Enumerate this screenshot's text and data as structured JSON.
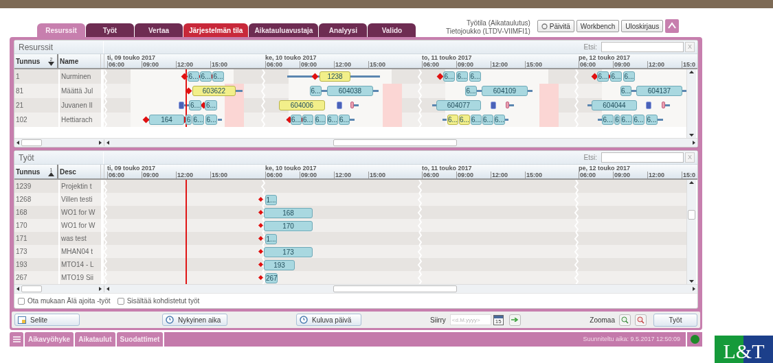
{
  "header": {
    "workspace": "Työtila (Aikataulutus)",
    "dataset": "Tietojoukko (LTDV-VIIMFI1)",
    "buttons": [
      {
        "label": "Päivitä",
        "kind": "refresh"
      },
      {
        "label": "Workbench",
        "kind": "plain"
      },
      {
        "label": "Uloskirjaus",
        "kind": "plain"
      }
    ]
  },
  "tabs": [
    {
      "label": "Resurssit",
      "selected": true,
      "warning": false
    },
    {
      "label": "Työt",
      "selected": false,
      "warning": false
    },
    {
      "label": "Vertaa",
      "selected": false,
      "warning": false
    },
    {
      "label": "Järjestelmän tila",
      "selected": false,
      "warning": true
    },
    {
      "label": "Aikatauluavustaja",
      "selected": false,
      "warning": false
    },
    {
      "label": "Analyysi",
      "selected": false,
      "warning": false
    },
    {
      "label": "Valido",
      "selected": false,
      "warning": false
    }
  ],
  "resources_panel": {
    "title": "Resurssit",
    "search_label": "Etsi:",
    "clear_button": "X",
    "columns": [
      {
        "label": "Tunnus",
        "sort_rank": "2",
        "ascending": false
      },
      {
        "label": "Name"
      }
    ],
    "days": [
      {
        "label": "ti, 09 touko 2017",
        "ticks": [
          "06:00",
          "09:00",
          "12:00",
          "15:00"
        ]
      },
      {
        "label": "ke, 10 touko 2017",
        "ticks": [
          "06:00",
          "09:00",
          "12:00",
          "15:00"
        ]
      },
      {
        "label": "to, 11 touko 2017",
        "ticks": [
          "06:00",
          "09:00",
          "12:00",
          "15:00"
        ]
      },
      {
        "label": "pe, 12 touko 2017",
        "ticks": [
          "06:00",
          "09:00",
          "12:00",
          "15:0"
        ]
      }
    ],
    "rows": [
      {
        "id": "1",
        "name": "Nurminen",
        "bars": [
          {
            "label": "6...",
            "color": "#a9d8e0"
          },
          {
            "label": "6...",
            "color": "#a9d8e0"
          },
          {
            "label": "6...",
            "color": "#a9d8e0"
          },
          {
            "label": "1238",
            "color": "#f2ef8a"
          },
          {
            "label": "6...",
            "color": "#a9d8e0"
          },
          {
            "label": "6...",
            "color": "#a9d8e0"
          },
          {
            "label": "6...",
            "color": "#a9d8e0"
          },
          {
            "label": "6...",
            "color": "#a9d8e0"
          },
          {
            "label": "6...",
            "color": "#a9d8e0"
          },
          {
            "label": "6...",
            "color": "#a9d8e0"
          }
        ]
      },
      {
        "id": "81",
        "name": "Määttä Jul",
        "bars": [
          {
            "label": "603622",
            "color": "#f2ef8a"
          },
          {
            "label": "6...",
            "color": "#a9d8e0"
          },
          {
            "label": "604038",
            "color": "#a9d8e0"
          },
          {
            "label": "6...",
            "color": "#a9d8e0"
          },
          {
            "label": "604109",
            "color": "#a9d8e0"
          },
          {
            "label": "6...",
            "color": "#a9d8e0"
          },
          {
            "label": "604137",
            "color": "#a9d8e0"
          }
        ]
      },
      {
        "id": "21",
        "name": "Juvanen Il",
        "bars": [
          {
            "label": "6...",
            "color": "#a9d8e0"
          },
          {
            "label": "6...",
            "color": "#a9d8e0"
          },
          {
            "label": "604006",
            "color": "#f2ef8a"
          },
          {
            "label": "604077",
            "color": "#a9d8e0"
          },
          {
            "label": "604044",
            "color": "#a9d8e0"
          }
        ]
      },
      {
        "id": "102",
        "name": "Hettiarach",
        "bars": [
          {
            "label": "164",
            "color": "#a9d8e0"
          },
          {
            "label": "6",
            "color": "#a9d8e0"
          },
          {
            "label": "6...",
            "color": "#a9d8e0"
          },
          {
            "label": "6...",
            "color": "#a9d8e0"
          },
          {
            "label": "6...",
            "color": "#a9d8e0"
          },
          {
            "label": "6...",
            "color": "#a9d8e0"
          },
          {
            "label": "6...",
            "color": "#a9d8e0"
          },
          {
            "label": "6...",
            "color": "#a9d8e0"
          },
          {
            "label": "6...",
            "color": "#a9d8e0"
          },
          {
            "label": "6...",
            "color": "#f2ef8a"
          },
          {
            "label": "6...",
            "color": "#f2ef8a"
          },
          {
            "label": "6...",
            "color": "#a9d8e0"
          },
          {
            "label": "6...",
            "color": "#a9d8e0"
          },
          {
            "label": "6...",
            "color": "#a9d8e0"
          },
          {
            "label": "6...",
            "color": "#a9d8e0"
          },
          {
            "label": "6",
            "color": "#a9d8e0"
          },
          {
            "label": "6...",
            "color": "#a9d8e0"
          },
          {
            "label": "6...",
            "color": "#a9d8e0"
          },
          {
            "label": "6...",
            "color": "#a9d8e0"
          }
        ]
      }
    ]
  },
  "jobs_panel": {
    "title": "Työt",
    "search_label": "Etsi:",
    "clear_button": "X",
    "columns": [
      {
        "label": "Tunnus",
        "sort_rank": "1",
        "ascending": true
      },
      {
        "label": "Desc"
      }
    ],
    "days": [
      {
        "label": "ti, 09 touko 2017",
        "ticks": [
          "06:00",
          "09:00",
          "12:00",
          "15:00"
        ]
      },
      {
        "label": "ke, 10 touko 2017",
        "ticks": [
          "06:00",
          "09:00",
          "12:00",
          "15:00"
        ]
      },
      {
        "label": "to, 11 touko 2017",
        "ticks": [
          "06:00",
          "09:00",
          "12:00",
          "15:00"
        ]
      },
      {
        "label": "pe, 12 touko 2017",
        "ticks": [
          "06:00",
          "09:00",
          "12:00",
          "15:0"
        ]
      }
    ],
    "rows": [
      {
        "id": "1239",
        "name": "Projektin t",
        "bars": []
      },
      {
        "id": "1268",
        "name": "Villen testi",
        "bars": [
          {
            "label": "1...",
            "color": "#a9d8e0"
          }
        ]
      },
      {
        "id": "168",
        "name": "WO1 for W",
        "bars": [
          {
            "label": "168",
            "color": "#a9d8e0"
          }
        ]
      },
      {
        "id": "170",
        "name": "WO1 for W",
        "bars": [
          {
            "label": "170",
            "color": "#a9d8e0"
          }
        ]
      },
      {
        "id": "171",
        "name": "was test",
        "bars": [
          {
            "label": "1...",
            "color": "#a9d8e0"
          }
        ]
      },
      {
        "id": "173",
        "name": "MHAN04 t",
        "bars": [
          {
            "label": "173",
            "color": "#a9d8e0"
          }
        ]
      },
      {
        "id": "193",
        "name": "MTO14 - L",
        "bars": [
          {
            "label": "193",
            "color": "#a9d8e0"
          }
        ]
      },
      {
        "id": "267",
        "name": "MTO19 Sii",
        "bars": [
          {
            "label": "267",
            "color": "#a9d8e0"
          }
        ]
      }
    ],
    "options": [
      {
        "label": "Ota mukaan Älä ajoita -työt",
        "checked": false
      },
      {
        "label": "Sisältää kohdistetut työt",
        "checked": false
      }
    ]
  },
  "toolbar": {
    "legend_button": "Selite",
    "now_button": "Nykyinen aika",
    "today_button": "Kuluva päivä",
    "goto_label": "Siirry",
    "date_placeholder": "<d.M.yyyy>",
    "calendar_day": "15",
    "zoom_label": "Zoomaa",
    "jobs_button": "Työt"
  },
  "bottom_bar": {
    "items": [
      "Aikavyöhyke",
      "Aikataulut",
      "Suodattimet"
    ],
    "status": "Suunniteltu aika: 9.5.2017 12:50:09",
    "online": true
  },
  "logo": {
    "text": "L&T"
  }
}
